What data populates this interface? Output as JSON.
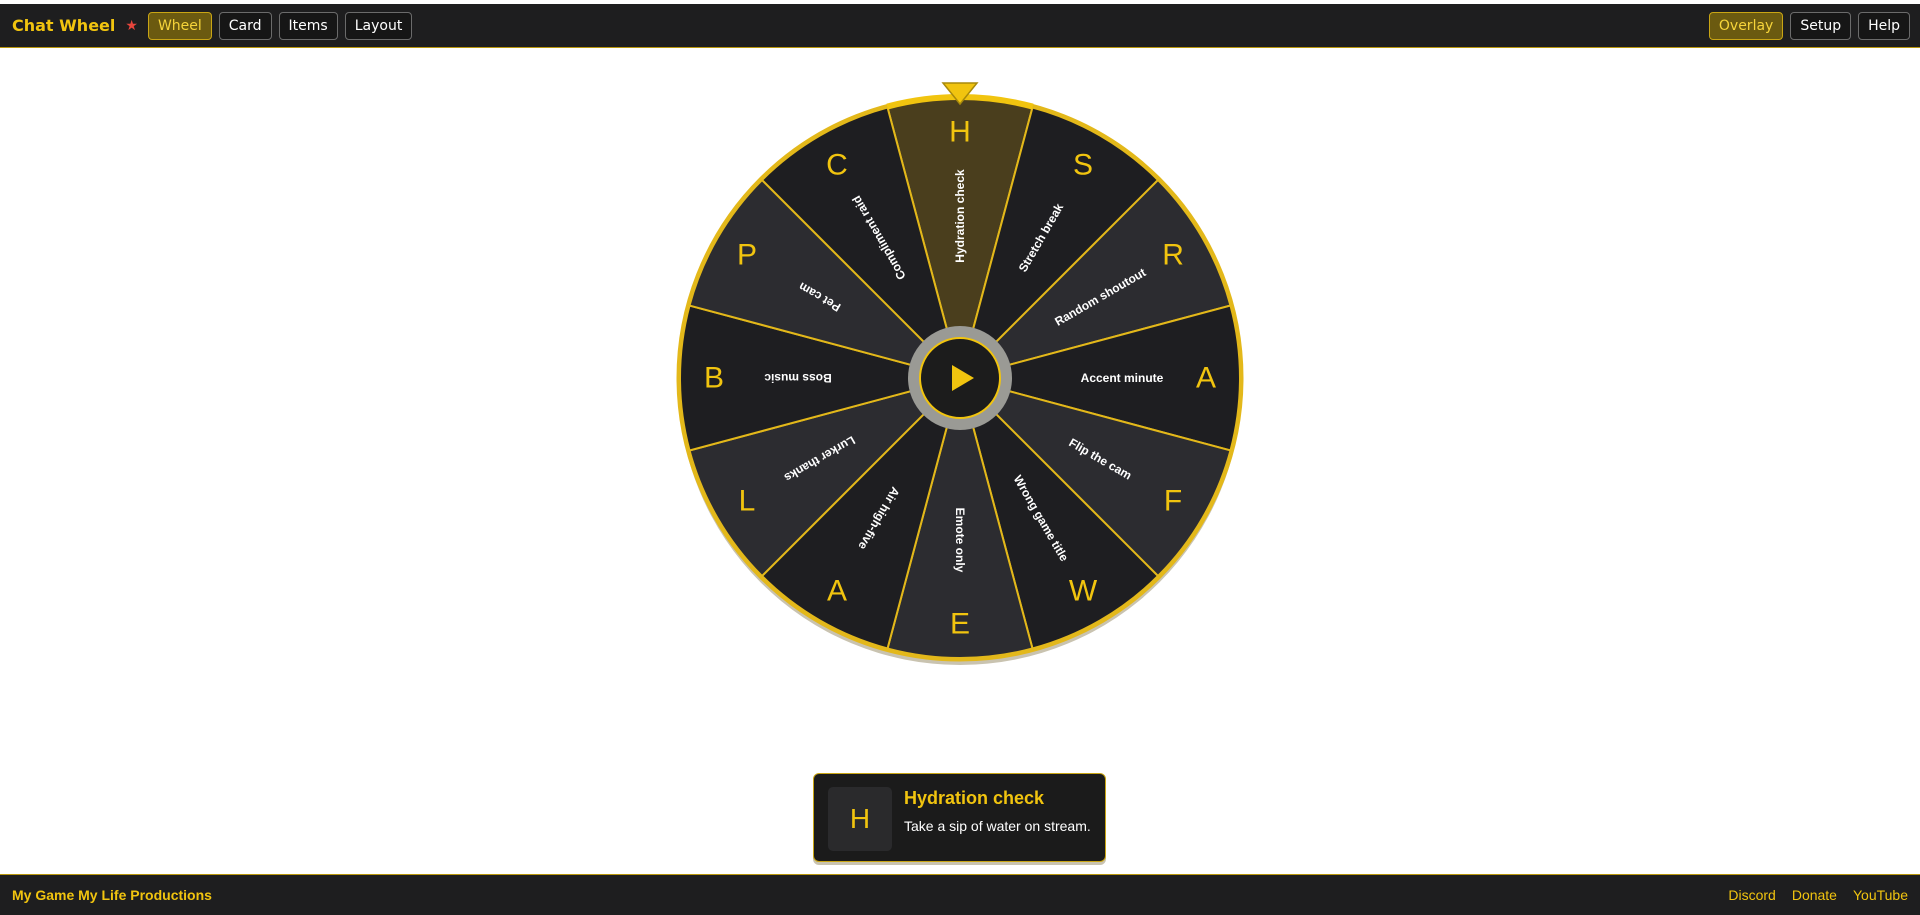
{
  "header": {
    "title": "Chat Wheel",
    "star": "★",
    "tabs": [
      {
        "label": "Wheel",
        "active": true
      },
      {
        "label": "Card",
        "active": false
      },
      {
        "label": "Items",
        "active": false
      },
      {
        "label": "Layout",
        "active": false
      }
    ],
    "right_buttons": [
      {
        "label": "Overlay",
        "active": true
      },
      {
        "label": "Setup",
        "active": false
      },
      {
        "label": "Help",
        "active": false
      }
    ]
  },
  "colors": {
    "accent": "#f1c40f",
    "wheel_outline": "#e3b81a",
    "slice_dark": "#1e1e21",
    "slice_light": "#2c2c30",
    "slice_selected": "#4a3e1d",
    "hub_ring": "#9a9a95"
  },
  "wheel": {
    "selected_index": 0,
    "play_icon": "play-icon",
    "pointer_icon": "pointer-triangle-icon",
    "slices": [
      {
        "letter": "H",
        "label": "Hydration check"
      },
      {
        "letter": "S",
        "label": "Stretch break"
      },
      {
        "letter": "R",
        "label": "Random shoutout"
      },
      {
        "letter": "A",
        "label": "Accent minute"
      },
      {
        "letter": "F",
        "label": "Flip the cam"
      },
      {
        "letter": "W",
        "label": "Wrong game title"
      },
      {
        "letter": "E",
        "label": "Emote only"
      },
      {
        "letter": "A",
        "label": "Air high-five"
      },
      {
        "letter": "L",
        "label": "Lurker thanks"
      },
      {
        "letter": "B",
        "label": "Boss music"
      },
      {
        "letter": "P",
        "label": "Pet cam"
      },
      {
        "letter": "C",
        "label": "Compliment raid"
      }
    ]
  },
  "result": {
    "letter": "H",
    "title": "Hydration check",
    "description": "Take a sip of water on stream."
  },
  "footer": {
    "company": "My Game My Life Productions",
    "links": [
      "Discord",
      "Donate",
      "YouTube"
    ]
  }
}
